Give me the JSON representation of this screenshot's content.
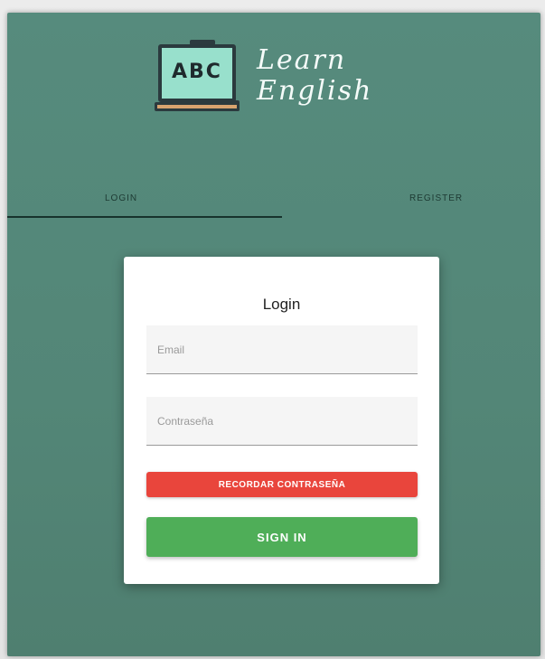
{
  "brand": {
    "board_text": "ABC",
    "title_line1": "Learn",
    "title_line2": "English"
  },
  "tabs": [
    {
      "label": "LOGIN",
      "active": true
    },
    {
      "label": "REGISTER",
      "active": false
    }
  ],
  "card": {
    "title": "Login",
    "email_placeholder": "Email",
    "password_placeholder": "Contraseña",
    "remember_label": "RECORDAR CONTRASEÑA",
    "signin_label": "SIGN IN"
  },
  "colors": {
    "background": "#548a7b",
    "tab_indicator": "#17332c",
    "remember_button": "#e9453c",
    "signin_button": "#4fae58"
  }
}
